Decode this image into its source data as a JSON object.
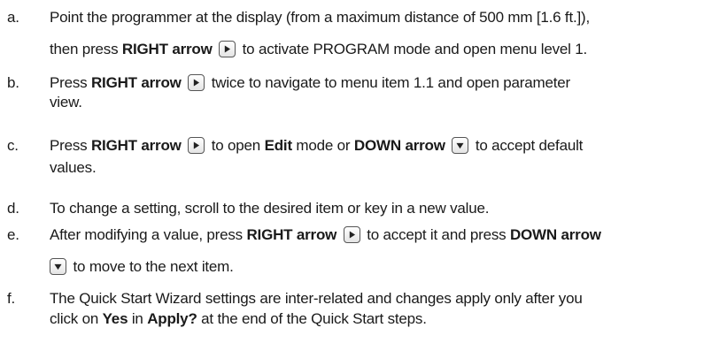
{
  "steps": [
    {
      "marker": "a.",
      "line1": {
        "t1": "Point the programmer at the display (from a maximum distance of 500 mm [1.6 ft.]),"
      },
      "line2": {
        "t1": "then press ",
        "b1": "RIGHT arrow",
        "t2": " to activate PROGRAM mode and open menu level 1."
      }
    },
    {
      "marker": "b.",
      "line1": {
        "t1": "Press ",
        "b1": "RIGHT arrow",
        "t2": " twice to navigate to menu item 1.1 and open parameter"
      },
      "line2": {
        "t1": "view."
      }
    },
    {
      "marker": "c.",
      "line1": {
        "t1": "Press ",
        "b1": "RIGHT arrow",
        "t2": " to open ",
        "b2": "Edit",
        "t3": " mode or ",
        "b3": "DOWN arrow",
        "t4": " to accept default"
      },
      "line2": {
        "t1": "values."
      }
    },
    {
      "marker": "d.",
      "line1": {
        "t1": "To change a setting, scroll to the desired item or key in a new value."
      }
    },
    {
      "marker": "e.",
      "line1": {
        "t1": "After modifying a value, press ",
        "b1": "RIGHT arrow",
        "t2": " to accept it and press ",
        "b2": "DOWN arrow"
      },
      "line2": {
        "t1": " to move to the next item."
      }
    },
    {
      "marker": "f.",
      "line1": {
        "t1": "The Quick Start Wizard settings are inter-related and changes apply only after you"
      },
      "line2": {
        "t1": "click on ",
        "b1": "Yes",
        "t2": " in ",
        "b2": "Apply?",
        "t3": " at the end of the Quick Start steps."
      }
    }
  ],
  "icons": {
    "right": "right-arrow-key-icon",
    "down": "down-arrow-key-icon"
  }
}
